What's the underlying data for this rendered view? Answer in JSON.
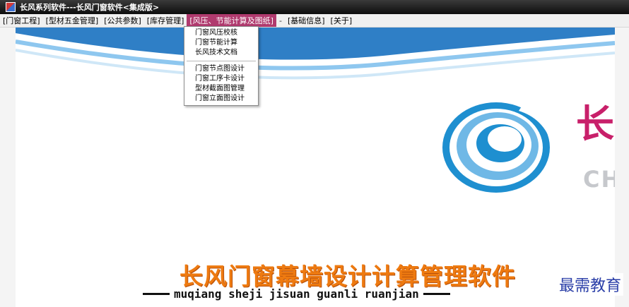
{
  "window": {
    "title": "长风系列软件---长风门窗软件<集成版>"
  },
  "menubar": {
    "items": [
      {
        "label": "[门窗工程]"
      },
      {
        "label": "[型材五金管理]"
      },
      {
        "label": "[公共参数]"
      },
      {
        "label": "[库存管理]"
      },
      {
        "label": "[风压、节能计算及图纸]"
      },
      {
        "label": "[基础信息]"
      },
      {
        "label": "[关于]"
      }
    ],
    "separator": "-"
  },
  "dropdown": {
    "group1": [
      "门窗风压校核",
      "门窗节能计算",
      "长风技术文档"
    ],
    "group2": [
      "门窗节点图设计",
      "门窗工序卡设计",
      "型材截面图管理",
      "门窗立面图设计"
    ]
  },
  "splash": {
    "brand_char": "长",
    "brand_initials": "CH",
    "slogan": "长风门窗幕墙设计计算管理软件",
    "pinyin": "muqiang sheji jisuan guanli ruanjian",
    "colors": {
      "brand": "#c8206a",
      "slogan": "#ee7a10",
      "logo_blue": "#1e8fd0"
    }
  },
  "watermark": "最需教育"
}
